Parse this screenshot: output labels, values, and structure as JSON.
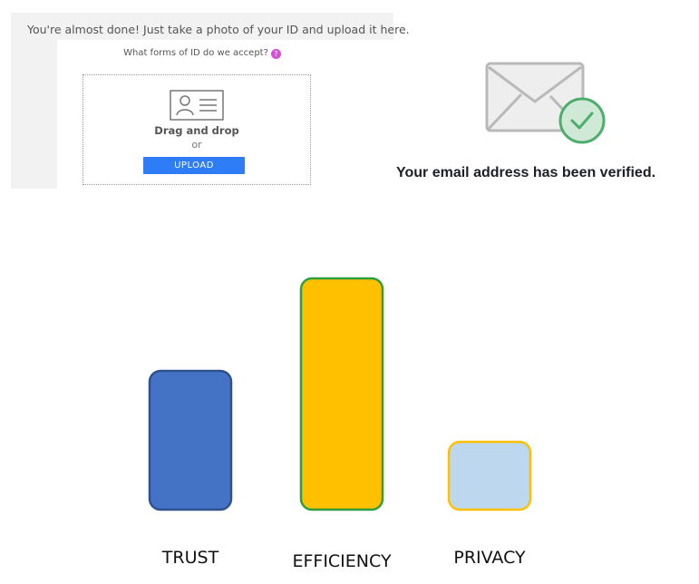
{
  "upload": {
    "instruction": "You're almost done! Just take a photo of your ID and upload it here.",
    "id_question": "What forms of ID do we accept?",
    "info_icon": "question-circle-icon",
    "drop_icon": "id-card-icon",
    "drag_label": "Drag and drop",
    "or_label": "or",
    "button_label": "UPLOAD",
    "button_color": "#2f7df6",
    "info_color": "#d54fd6"
  },
  "verification": {
    "icon": "envelope-check-icon",
    "message": "Your email address has been verified.",
    "check_color": "#4cae6a"
  },
  "chart_data": {
    "type": "bar",
    "categories": [
      "TRUST",
      "EFFICIENCY",
      "PRIVACY"
    ],
    "values": [
      4.5,
      7.5,
      2.2
    ],
    "ylim": [
      0,
      8
    ],
    "colors": [
      "#4472c4",
      "#ffc000",
      "#bdd7ee"
    ],
    "border_colors": [
      "#2f528f",
      "#2e9e3e",
      "#ffc000"
    ],
    "grid": false,
    "legend": "none",
    "title": "",
    "xlabel": "",
    "ylabel": ""
  }
}
